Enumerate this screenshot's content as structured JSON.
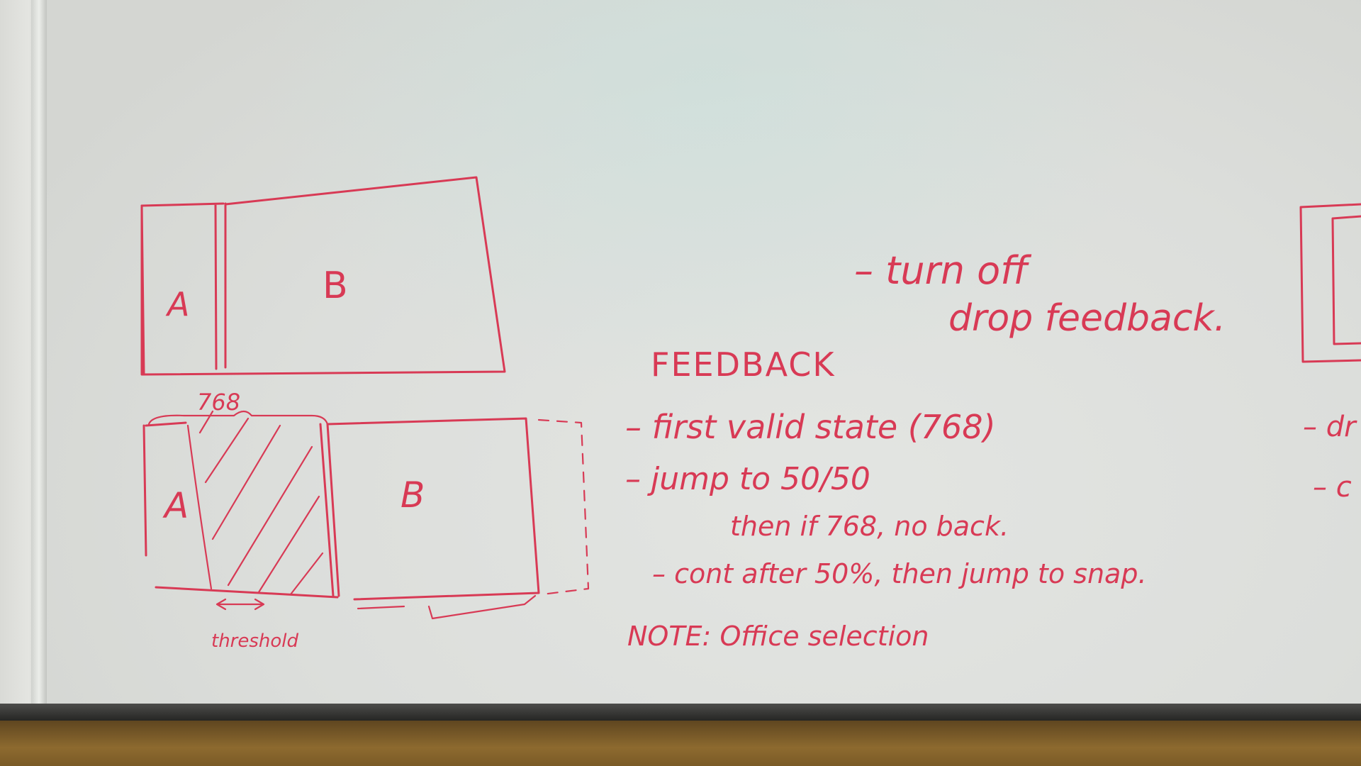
{
  "whiteboard": {
    "ink_color": "#d83a55",
    "sketch_top": {
      "label_a": "A",
      "label_b": "B"
    },
    "sketch_bottom": {
      "width_label": "768",
      "label_a": "A",
      "label_b": "B",
      "threshold_label": "threshold"
    },
    "notes": {
      "top_note_line1": "– turn off",
      "top_note_line2": "drop feedback.",
      "heading": "FEEDBACK",
      "items": [
        "– first valid state (768)",
        "– jump to 50/50",
        "then if 768, no back.",
        "– cont after 50%, then jump to snap.",
        "NOTE: Office selection"
      ]
    },
    "right_edge_fragments": [
      "– dr",
      "– c"
    ]
  }
}
